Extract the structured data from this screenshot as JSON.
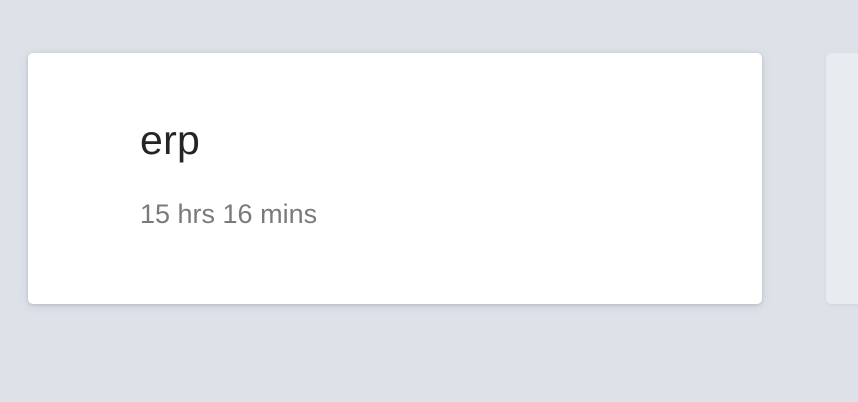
{
  "project_card": {
    "name": "erp",
    "duration": "15 hrs 16 mins"
  },
  "colors": {
    "background": "#dde1e8",
    "card": "#ffffff",
    "title_text": "#252525",
    "duration_text": "#7a7a7a"
  }
}
